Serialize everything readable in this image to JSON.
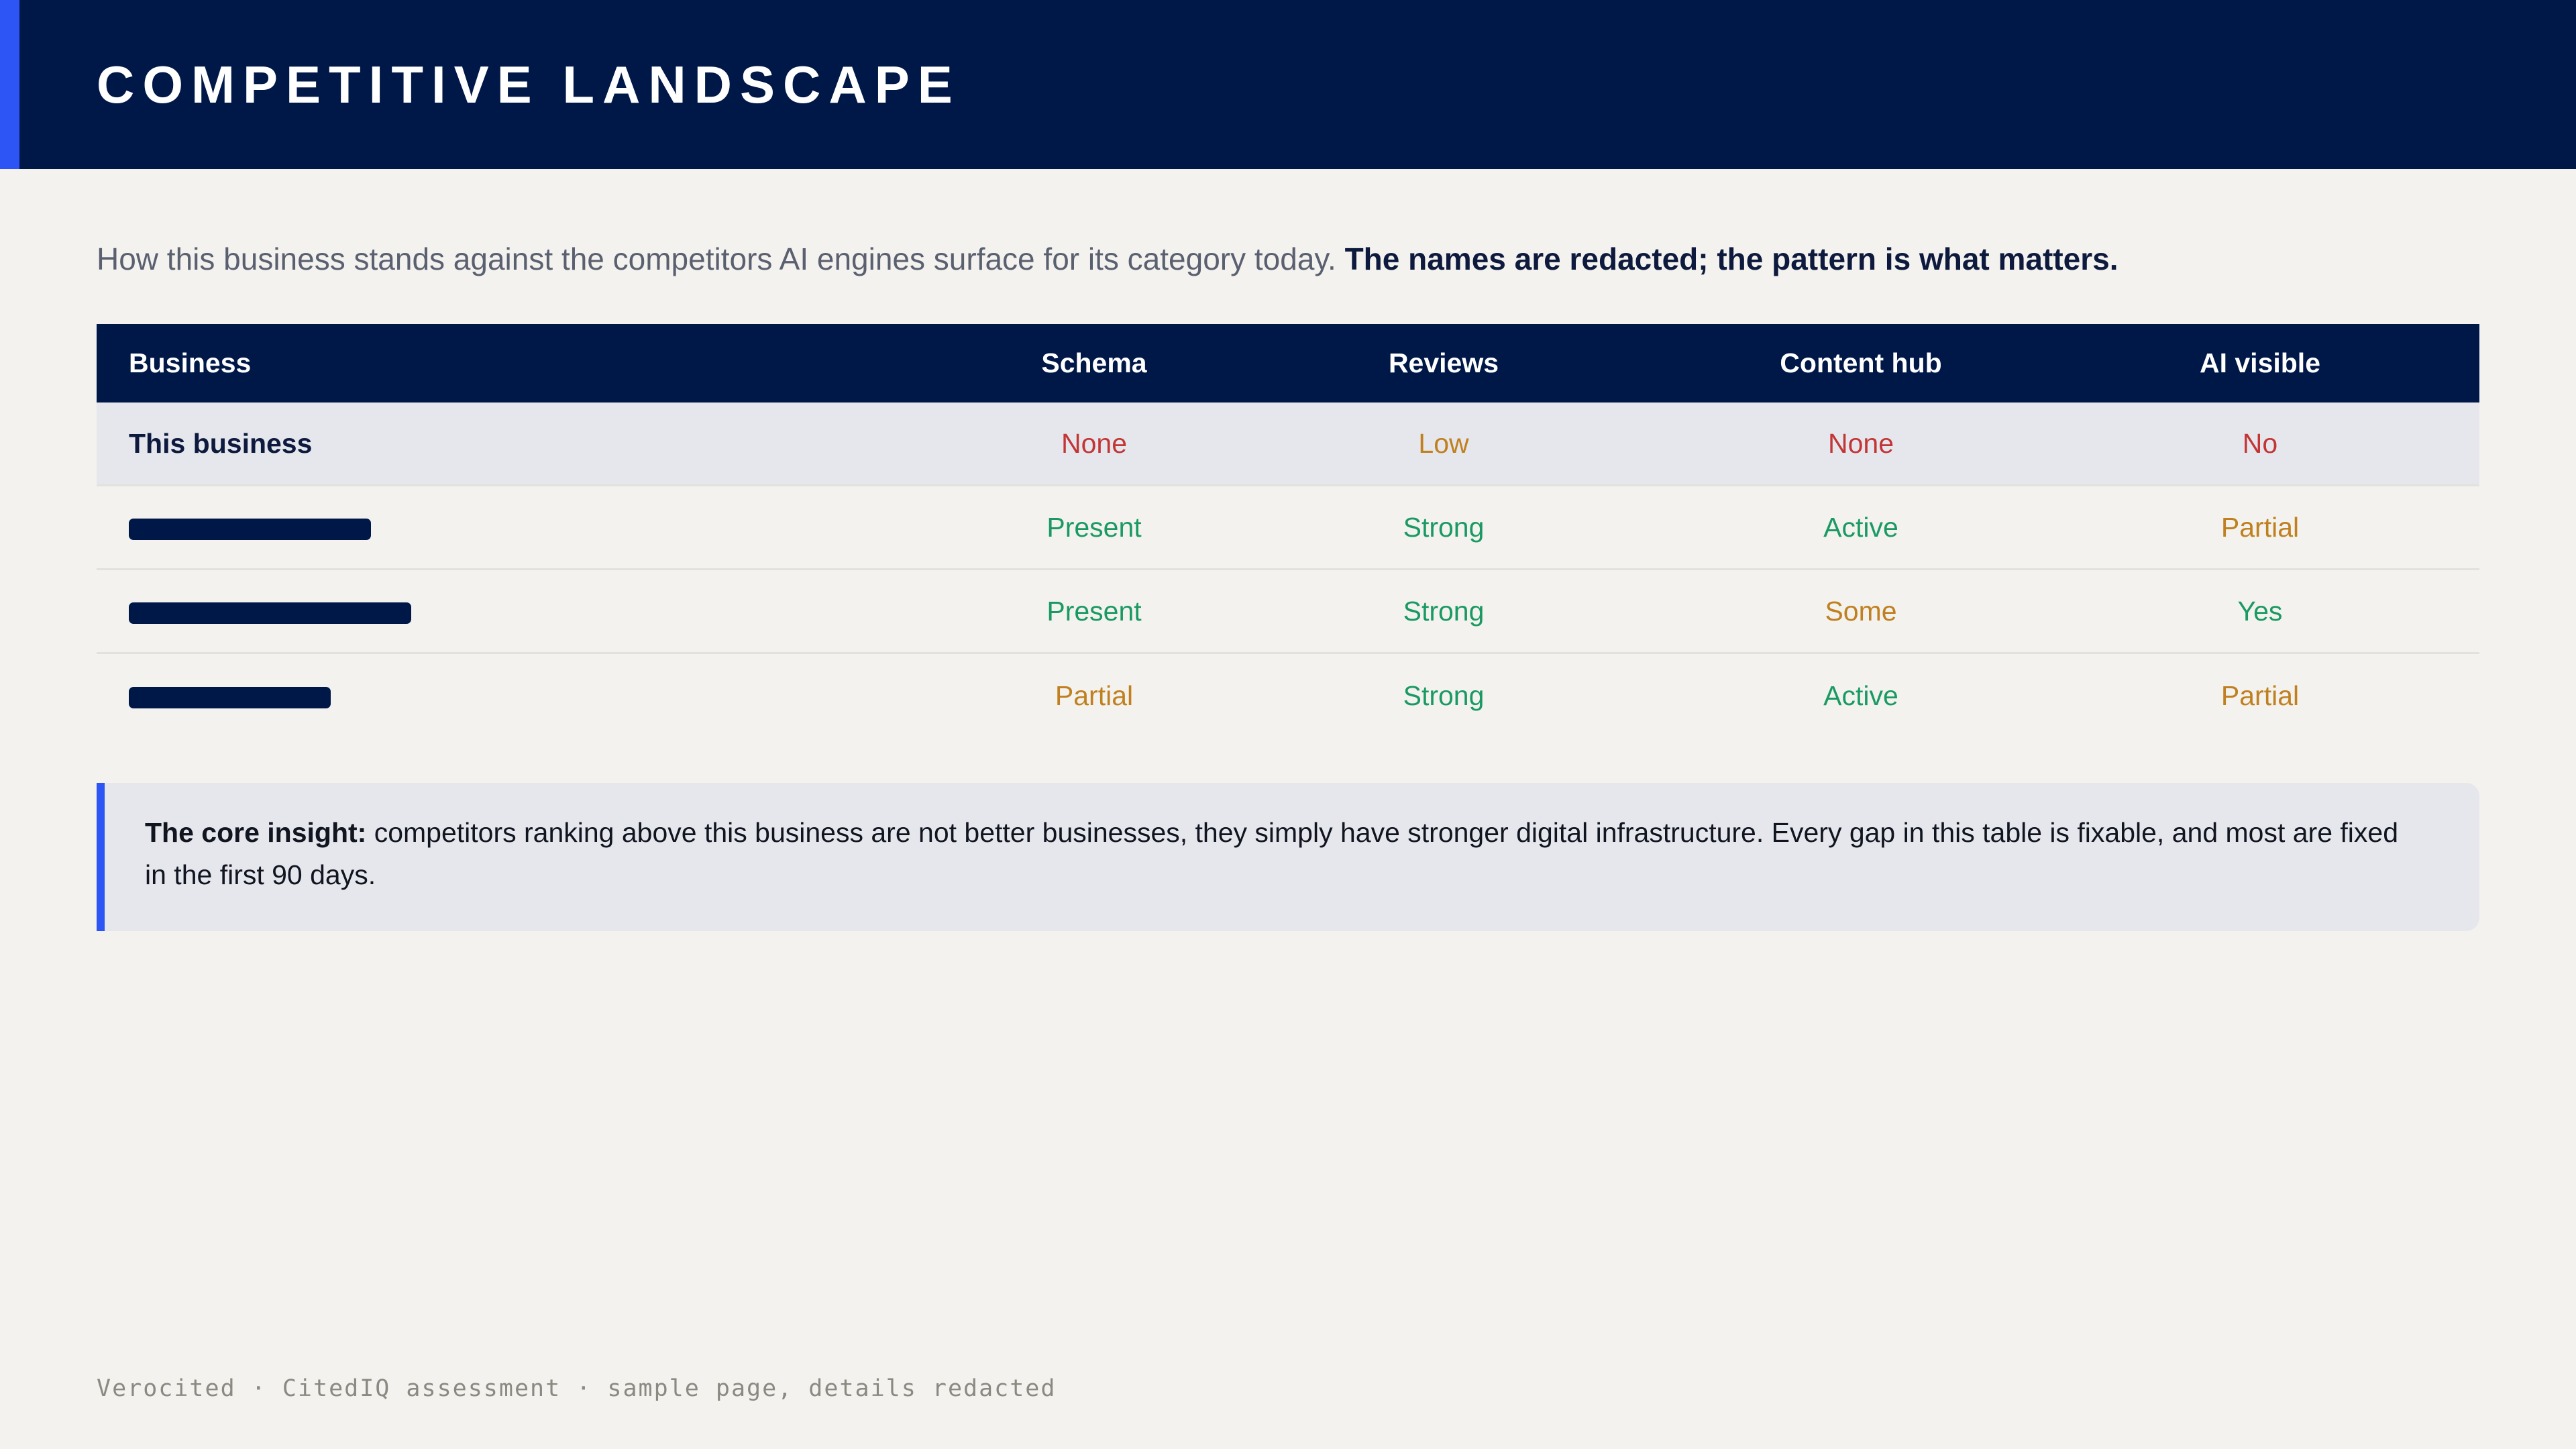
{
  "header": {
    "title": "COMPETITIVE LANDSCAPE"
  },
  "intro": {
    "text": "How this business stands against the competitors AI engines surface for its category today. ",
    "emphasis": "The names are redacted; the pattern is what matters."
  },
  "table": {
    "columns": [
      "Business",
      "Schema",
      "Reviews",
      "Content hub",
      "AI visible"
    ],
    "rows": [
      {
        "business": "This business",
        "redacted": false,
        "schema": "None",
        "reviews": "Low",
        "content_hub": "None",
        "ai_visible": "No"
      },
      {
        "business": "",
        "redacted": true,
        "schema": "Present",
        "reviews": "Strong",
        "content_hub": "Active",
        "ai_visible": "Partial"
      },
      {
        "business": "",
        "redacted": true,
        "schema": "Present",
        "reviews": "Strong",
        "content_hub": "Some",
        "ai_visible": "Yes"
      },
      {
        "business": "",
        "redacted": true,
        "schema": "Partial",
        "reviews": "Strong",
        "content_hub": "Active",
        "ai_visible": "Partial"
      }
    ]
  },
  "insight": {
    "lead": "The core insight:",
    "text": " competitors ranking above this business are not better businesses, they simply have stronger digital infrastructure. Every gap in this table is fixable, and most are fixed in the first 90 days."
  },
  "footer": {
    "text": "Verocited · CitedIQ assessment · sample page, details redacted"
  },
  "colors": {
    "navy": "#001848",
    "accent_blue": "#2d54f5",
    "status_bad": "#c23636",
    "status_warn": "#c0801f",
    "status_good": "#1a9a62"
  }
}
